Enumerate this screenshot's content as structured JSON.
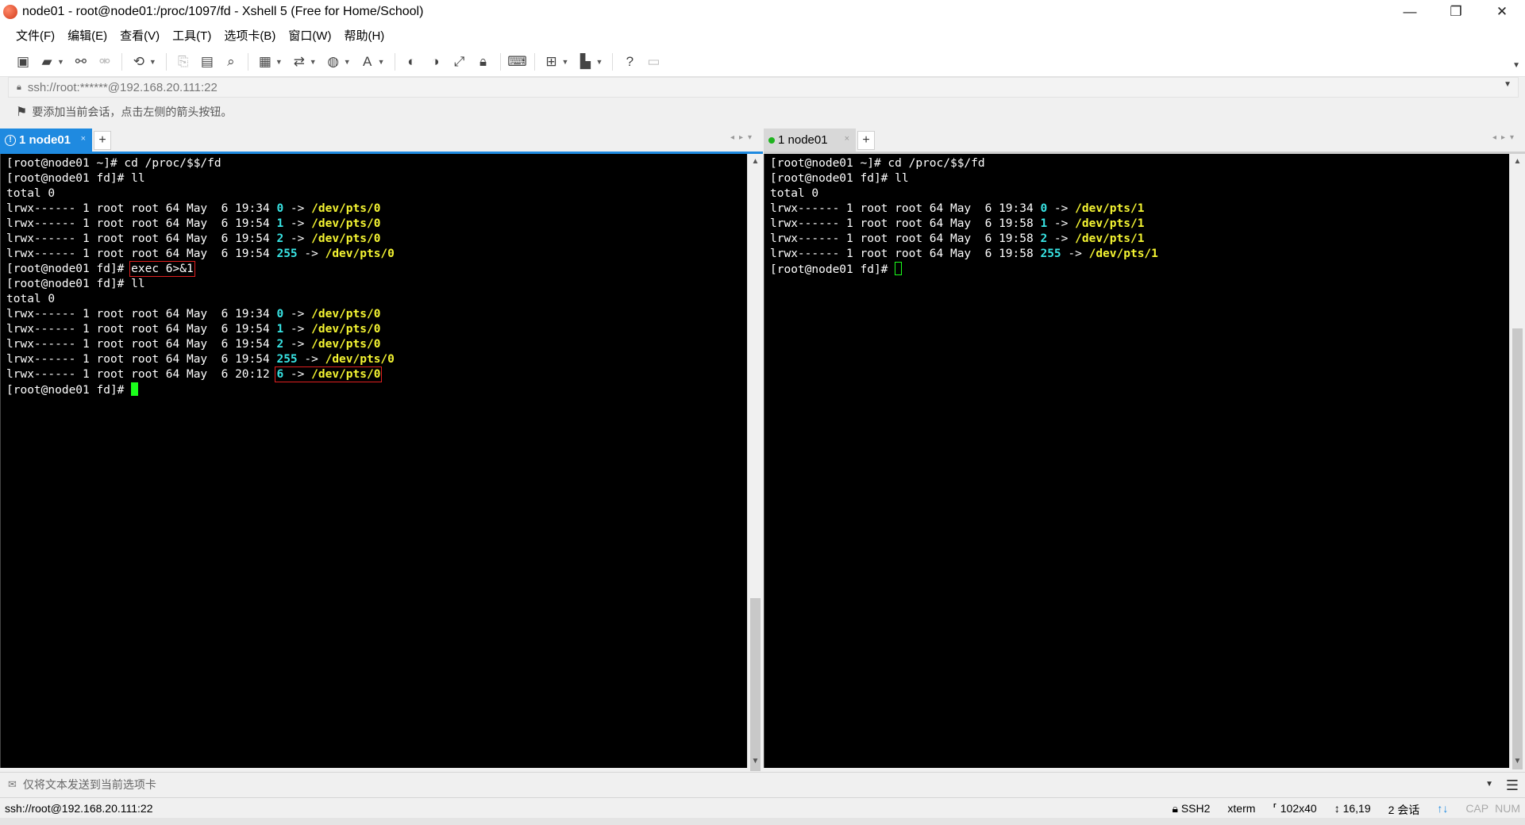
{
  "window": {
    "title": "node01 - root@node01:/proc/1097/fd - Xshell 5 (Free for Home/School)",
    "minimize": "—",
    "restore": "❐",
    "close": "✕"
  },
  "menu": [
    "文件(F)",
    "编辑(E)",
    "查看(V)",
    "工具(T)",
    "选项卡(B)",
    "窗口(W)",
    "帮助(H)"
  ],
  "address": {
    "text": "ssh://root:******@192.168.20.111:22"
  },
  "hint": {
    "text": "要添加当前会话，点击左侧的箭头按钮。"
  },
  "left_pane": {
    "tab_label": "1 node01",
    "tab_close": "×",
    "tab_add": "+",
    "accent": "#1f8ae0",
    "lines": [
      [
        {
          "t": "[root@node01 ~]# cd /proc/$$/fd"
        }
      ],
      [
        {
          "t": "[root@node01 fd]# ll"
        }
      ],
      [
        {
          "t": "total 0"
        }
      ],
      [
        {
          "t": "lrwx------ 1 root root 64 May  6 19:34 "
        },
        {
          "t": "0",
          "c": "cyan"
        },
        {
          "t": " -> "
        },
        {
          "t": "/dev/pts/0",
          "c": "yellow"
        }
      ],
      [
        {
          "t": "lrwx------ 1 root root 64 May  6 19:54 "
        },
        {
          "t": "1",
          "c": "cyan"
        },
        {
          "t": " -> "
        },
        {
          "t": "/dev/pts/0",
          "c": "yellow"
        }
      ],
      [
        {
          "t": "lrwx------ 1 root root 64 May  6 19:54 "
        },
        {
          "t": "2",
          "c": "cyan"
        },
        {
          "t": " -> "
        },
        {
          "t": "/dev/pts/0",
          "c": "yellow"
        }
      ],
      [
        {
          "t": "lrwx------ 1 root root 64 May  6 19:54 "
        },
        {
          "t": "255",
          "c": "cyan"
        },
        {
          "t": " -> "
        },
        {
          "t": "/dev/pts/0",
          "c": "yellow"
        }
      ],
      [
        {
          "t": "[root@node01 fd]# "
        },
        {
          "t": "exec 6>&1",
          "box": true
        }
      ],
      [
        {
          "t": "[root@node01 fd]# ll"
        }
      ],
      [
        {
          "t": "total 0"
        }
      ],
      [
        {
          "t": "lrwx------ 1 root root 64 May  6 19:34 "
        },
        {
          "t": "0",
          "c": "cyan"
        },
        {
          "t": " -> "
        },
        {
          "t": "/dev/pts/0",
          "c": "yellow"
        }
      ],
      [
        {
          "t": "lrwx------ 1 root root 64 May  6 19:54 "
        },
        {
          "t": "1",
          "c": "cyan"
        },
        {
          "t": " -> "
        },
        {
          "t": "/dev/pts/0",
          "c": "yellow"
        }
      ],
      [
        {
          "t": "lrwx------ 1 root root 64 May  6 19:54 "
        },
        {
          "t": "2",
          "c": "cyan"
        },
        {
          "t": " -> "
        },
        {
          "t": "/dev/pts/0",
          "c": "yellow"
        }
      ],
      [
        {
          "t": "lrwx------ 1 root root 64 May  6 19:54 "
        },
        {
          "t": "255",
          "c": "cyan"
        },
        {
          "t": " -> "
        },
        {
          "t": "/dev/pts/0",
          "c": "yellow"
        }
      ],
      [
        {
          "t": "lrwx------ 1 root root 64 May  6 20:12 "
        },
        {
          "t": "6",
          "c": "cyan",
          "box": "start"
        },
        {
          "t": " -> ",
          "box": "mid"
        },
        {
          "t": "/dev/pts/0",
          "c": "yellow",
          "box": "end"
        }
      ],
      [
        {
          "t": "[root@node01 fd]# "
        },
        {
          "cursor": "block"
        }
      ]
    ]
  },
  "right_pane": {
    "tab_label": "1 node01",
    "tab_close": "×",
    "tab_add": "+",
    "lines": [
      [
        {
          "t": "[root@node01 ~]# cd /proc/$$/fd"
        }
      ],
      [
        {
          "t": "[root@node01 fd]# ll"
        }
      ],
      [
        {
          "t": "total 0"
        }
      ],
      [
        {
          "t": "lrwx------ 1 root root 64 May  6 19:34 "
        },
        {
          "t": "0",
          "c": "cyan"
        },
        {
          "t": " -> "
        },
        {
          "t": "/dev/pts/1",
          "c": "yellow"
        }
      ],
      [
        {
          "t": "lrwx------ 1 root root 64 May  6 19:58 "
        },
        {
          "t": "1",
          "c": "cyan"
        },
        {
          "t": " -> "
        },
        {
          "t": "/dev/pts/1",
          "c": "yellow"
        }
      ],
      [
        {
          "t": "lrwx------ 1 root root 64 May  6 19:58 "
        },
        {
          "t": "2",
          "c": "cyan"
        },
        {
          "t": " -> "
        },
        {
          "t": "/dev/pts/1",
          "c": "yellow"
        }
      ],
      [
        {
          "t": "lrwx------ 1 root root 64 May  6 19:58 "
        },
        {
          "t": "255",
          "c": "cyan"
        },
        {
          "t": " -> "
        },
        {
          "t": "/dev/pts/1",
          "c": "yellow"
        }
      ],
      [
        {
          "t": "[root@node01 fd]# "
        },
        {
          "cursor": "hollow"
        }
      ]
    ]
  },
  "sendbar": {
    "text": "仅将文本发送到当前选项卡"
  },
  "status": {
    "connection": "ssh://root@192.168.20.111:22",
    "protocol": "SSH2",
    "terminal": "xterm",
    "size": "102x40",
    "position": "16,19",
    "sessions": "2 会话",
    "cap": "CAP",
    "num": "NUM"
  }
}
